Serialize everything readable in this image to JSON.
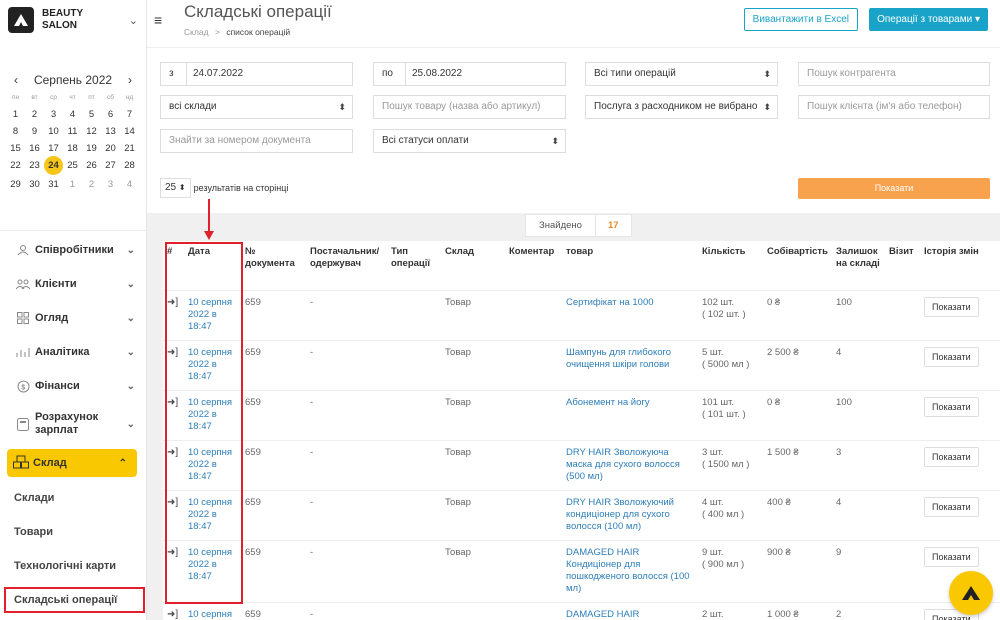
{
  "brand": {
    "line1": "BEAUTY",
    "line2": "SALON"
  },
  "calendar": {
    "month": "Серпень 2022",
    "prev": "‹",
    "next": "›",
    "dow": [
      "пн",
      "вт",
      "ср",
      "чт",
      "пт",
      "сб",
      "нд"
    ],
    "weeks": [
      [
        "1",
        "2",
        "3",
        "4",
        "5",
        "6",
        "7"
      ],
      [
        "8",
        "9",
        "10",
        "11",
        "12",
        "13",
        "14"
      ],
      [
        "15",
        "16",
        "17",
        "18",
        "19",
        "20",
        "21"
      ],
      [
        "22",
        "23",
        "24",
        "25",
        "26",
        "27",
        "28"
      ],
      [
        "29",
        "30",
        "31",
        "1",
        "2",
        "3",
        "4"
      ]
    ],
    "today": "24"
  },
  "nav": {
    "employees": "Співробітники",
    "clients": "Клієнти",
    "overview": "Огляд",
    "analytics": "Аналітика",
    "finance": "Фінанси",
    "salary_line1": "Розрахунок",
    "salary_line2": "зарплат",
    "warehouse": "Склад",
    "sub": [
      "Склади",
      "Товари",
      "Технологічні карти",
      "Складські операції"
    ]
  },
  "header": {
    "title": "Складські операції",
    "crumb_root": "Склад",
    "crumb_sep": ">",
    "crumb_current": "список операцій",
    "export_button": "Вивантажити в Excel",
    "ops_button": "Операції з товарами ▾"
  },
  "filters": {
    "from_prefix": "з",
    "from_value": "24.07.2022",
    "to_prefix": "по",
    "to_value": "25.08.2022",
    "op_type": "Всі типи операцій",
    "counterparty_placeholder": "Пошук контрагента",
    "warehouse": "всі склади",
    "product_placeholder": "Пошук товару (назва або артикул)",
    "service": "Послуга з расходником не вибрано",
    "client_placeholder": "Пошук клієнта (ім'я або телефон)",
    "doc_placeholder": "Знайти за номером документа",
    "payment_status": "Всі статуси оплати",
    "per_page": "25",
    "per_page_label": "результатів на сторінці",
    "show_button": "Показати"
  },
  "results": {
    "found_label": "Знайдено",
    "found_count": "17"
  },
  "table": {
    "headers": [
      "#",
      "Дата",
      "№ документа",
      "Постачальник/ одержувач",
      "Тип операції",
      "Склад",
      "Коментар",
      "товар",
      "Кількість",
      "Собівартість",
      "Залишок на складі",
      "Візит",
      "Історія змін"
    ],
    "rows": [
      {
        "date": "10 серпня 2022 в 18:47",
        "doc": "659",
        "party": "-",
        "type": "",
        "stock": "Товар",
        "comment": "",
        "product": "Сертифікат на 1000",
        "qty": "102 шт.",
        "qty2": "( 102 шт. )",
        "cost": "0 ₴",
        "left": "100",
        "visit": "",
        "hist": "Показати"
      },
      {
        "date": "10 серпня 2022 в 18:47",
        "doc": "659",
        "party": "-",
        "type": "",
        "stock": "Товар",
        "comment": "",
        "product": "Шампунь для глибокого очищення шкіри голови",
        "qty": "5 шт.",
        "qty2": "( 5000 мл )",
        "cost": "2 500 ₴",
        "left": "4",
        "visit": "",
        "hist": "Показати"
      },
      {
        "date": "10 серпня 2022 в 18:47",
        "doc": "659",
        "party": "-",
        "type": "",
        "stock": "Товар",
        "comment": "",
        "product": "Абонемент на йогу",
        "qty": "101 шт.",
        "qty2": "( 101 шт. )",
        "cost": "0 ₴",
        "left": "100",
        "visit": "",
        "hist": "Показати"
      },
      {
        "date": "10 серпня 2022 в 18:47",
        "doc": "659",
        "party": "-",
        "type": "",
        "stock": "Товар",
        "comment": "",
        "product": "DRY HAIR Зволожуюча маска для сухого волосся (500 мл)",
        "qty": "3 шт.",
        "qty2": "( 1500 мл )",
        "cost": "1 500 ₴",
        "left": "3",
        "visit": "",
        "hist": "Показати"
      },
      {
        "date": "10 серпня 2022 в 18:47",
        "doc": "659",
        "party": "-",
        "type": "",
        "stock": "Товар",
        "comment": "",
        "product": "DRY HAIR Зволожуючий кондиціонер для сухого волосся (100 мл)",
        "qty": "4 шт.",
        "qty2": "( 400 мл )",
        "cost": "400 ₴",
        "left": "4",
        "visit": "",
        "hist": "Показати"
      },
      {
        "date": "10 серпня 2022 в 18:47",
        "doc": "659",
        "party": "-",
        "type": "",
        "stock": "Товар",
        "comment": "",
        "product": "DAMAGED HAIR Кондиціонер для пошкодженого волосся (100 мл)",
        "qty": "9 шт.",
        "qty2": "( 900 мл )",
        "cost": "900 ₴",
        "left": "9",
        "visit": "",
        "hist": "Показати"
      },
      {
        "date": "10 серпня",
        "doc": "659",
        "party": "-",
        "type": "",
        "stock": "",
        "comment": "",
        "product": "DAMAGED HAIR",
        "qty": "2 шт.",
        "qty2": "",
        "cost": "1 000 ₴",
        "left": "2",
        "visit": "",
        "hist": "Показати"
      }
    ]
  },
  "colors": {
    "accent": "#1aa3c8",
    "brand_yellow": "#f9c800",
    "show_orange": "#f9a24d",
    "highlight_red": "#e0202c",
    "link": "#2e7eb8"
  }
}
